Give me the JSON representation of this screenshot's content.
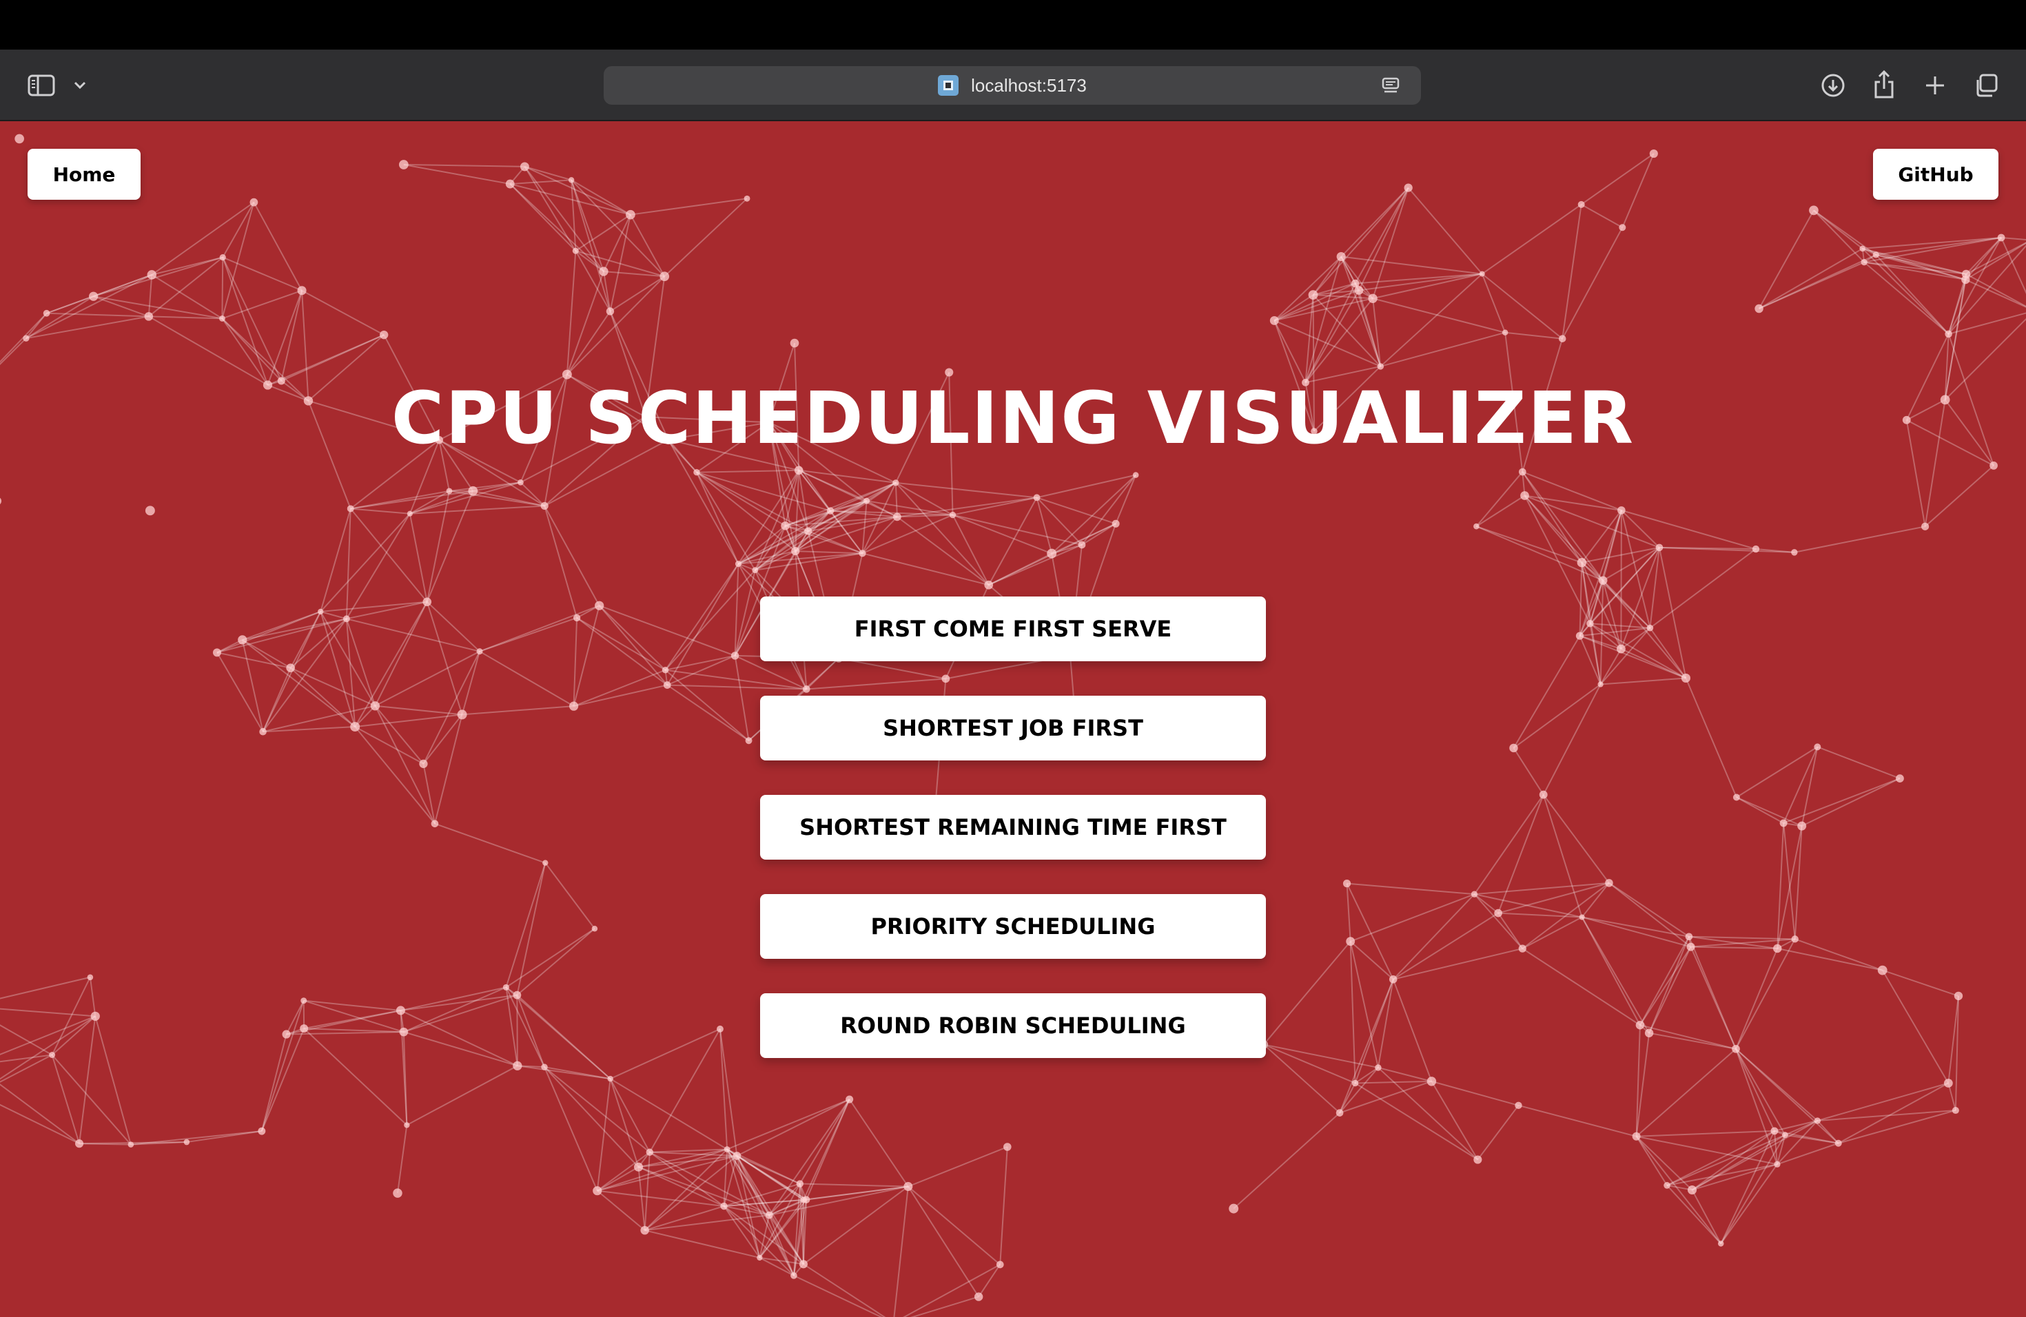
{
  "browser": {
    "url": "localhost:5173"
  },
  "nav": {
    "home_label": "Home",
    "github_label": "GitHub"
  },
  "hero": {
    "title": "CPU SCHEDULING VISUALIZER"
  },
  "algorithms": [
    {
      "label": "FIRST COME FIRST SERVE"
    },
    {
      "label": "SHORTEST JOB FIRST"
    },
    {
      "label": "SHORTEST REMAINING TIME FIRST"
    },
    {
      "label": "PRIORITY SCHEDULING"
    },
    {
      "label": "ROUND ROBIN SCHEDULING"
    }
  ],
  "colors": {
    "background": "#a72a2e",
    "button": "#ffffff",
    "text_on_button": "#000000",
    "title": "#ffffff"
  }
}
